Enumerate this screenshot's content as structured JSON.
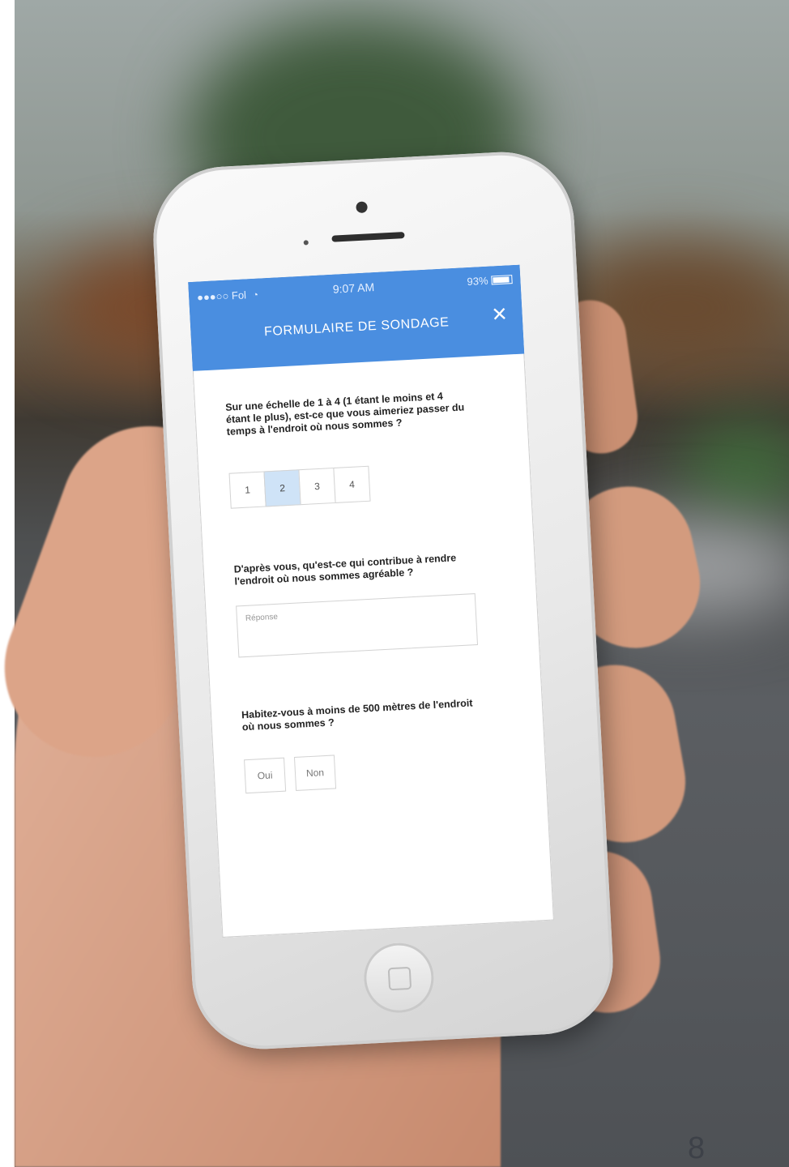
{
  "status_bar": {
    "carrier": "●●●○○ Fol",
    "wifi_icon": "wifi-icon",
    "time": "9:07 AM",
    "battery": "93%"
  },
  "app_bar": {
    "title": "FORMULAIRE DE SONDAGE",
    "close_label": "✕",
    "color": "#4a8ee0"
  },
  "questions": {
    "q1": {
      "text": "Sur une échelle de 1 à 4 (1 étant le moins et 4 étant le plus), est-ce que vous aimeriez passer du temps à l'endroit où nous sommes ?",
      "options": [
        "1",
        "2",
        "3",
        "4"
      ],
      "selected": "2"
    },
    "q2": {
      "text": "D'après vous, qu'est-ce qui contribue à rendre l'endroit où nous sommes agréable ?",
      "placeholder": "Réponse"
    },
    "q3": {
      "text": "Habitez-vous à moins de 500 mètres de l'endroit où nous sommes ?",
      "yes_label": "Oui",
      "no_label": "Non"
    }
  },
  "page_number": "8"
}
